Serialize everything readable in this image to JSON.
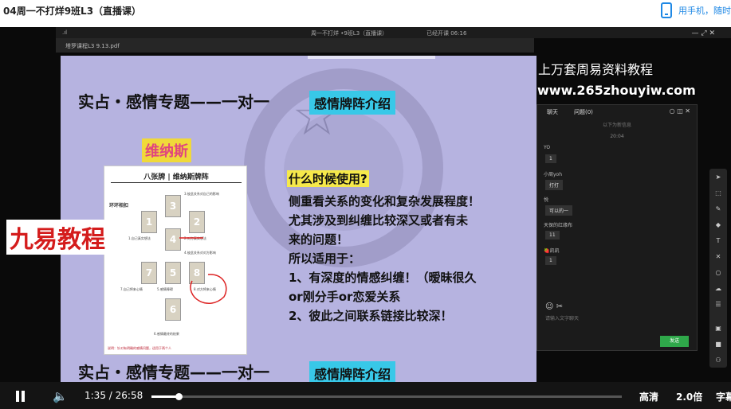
{
  "header": {
    "title": "04周一不打烊9班L3（直播课）",
    "phone_text": "用手机，随时"
  },
  "inner_window": {
    "title": "周一不打烊 •9班L3（直播课）",
    "live_text": "已经开课 06:16",
    "file_name": "塔罗课程L3 9.13.pdf"
  },
  "slide": {
    "section_title": "实占・感情专题——一对一",
    "section_tag": "感情牌阵介绍",
    "venus_label": "维纳斯",
    "card": {
      "title": "八张牌 | 维纳斯牌阵",
      "ring_tag": "环环相扣",
      "tiles": [
        "3",
        "1",
        "4",
        "2",
        "7",
        "5",
        "8",
        "6"
      ],
      "labels": [
        "3.彼此关系对自己的影响",
        "1.自己真实想法",
        "2.对方真实想法",
        "4.彼此关系对对方影响",
        "7.自己将来心情",
        "5.感情障碍",
        "8.对方将来心情",
        "6.感情最终的结果"
      ],
      "footer": "说明：针对有明确的感情问题，适用于两个人"
    },
    "question": "什么时候使用?",
    "lines": [
      "侧重看关系的变化和复杂发展程度！",
      "尤其涉及到纠缠比较深又或者有未",
      "来的问题！",
      "所以适用于：",
      "1、有深度的情感纠缠！（暧昧很久",
      "or刚分手or恋爱关系",
      "2、彼此之间联系链接比较深！"
    ],
    "bottom_title": "实占・感情专题——一对一",
    "bottom_tag": "感情牌阵介绍"
  },
  "overlay": {
    "jiuyi": "九易教程",
    "watermark_1": "上万套周易资料教程",
    "watermark_2": "www.265zhouyiw.com"
  },
  "chat": {
    "tab_chat": "聊天",
    "tab_qa": "问题(0)",
    "divider": "以下为新信息",
    "time": "20:04",
    "messages": [
      {
        "name": "YO",
        "text": "1"
      },
      {
        "name": "小周yoh",
        "text": "打打"
      },
      {
        "name": "悦",
        "text": "可以的一"
      },
      {
        "name": "天保的红缘布",
        "text": "11"
      },
      {
        "name": "🍓凯凯",
        "text": "1"
      }
    ],
    "tool_icons": "☺ ✂",
    "input_placeholder": "请输入文字聊天",
    "send_label": "发送"
  },
  "player": {
    "current_time": "1:35",
    "separator": "/",
    "duration": "26:58",
    "progress": 0.058,
    "quality": "高清",
    "speed": "2.0倍",
    "subtitle": "字幕"
  },
  "colors": {
    "accent": "#1e88e5",
    "slide_bg": "#b6b3e0",
    "tag_bg": "#38c8e8",
    "send_green": "#2fa84a"
  }
}
